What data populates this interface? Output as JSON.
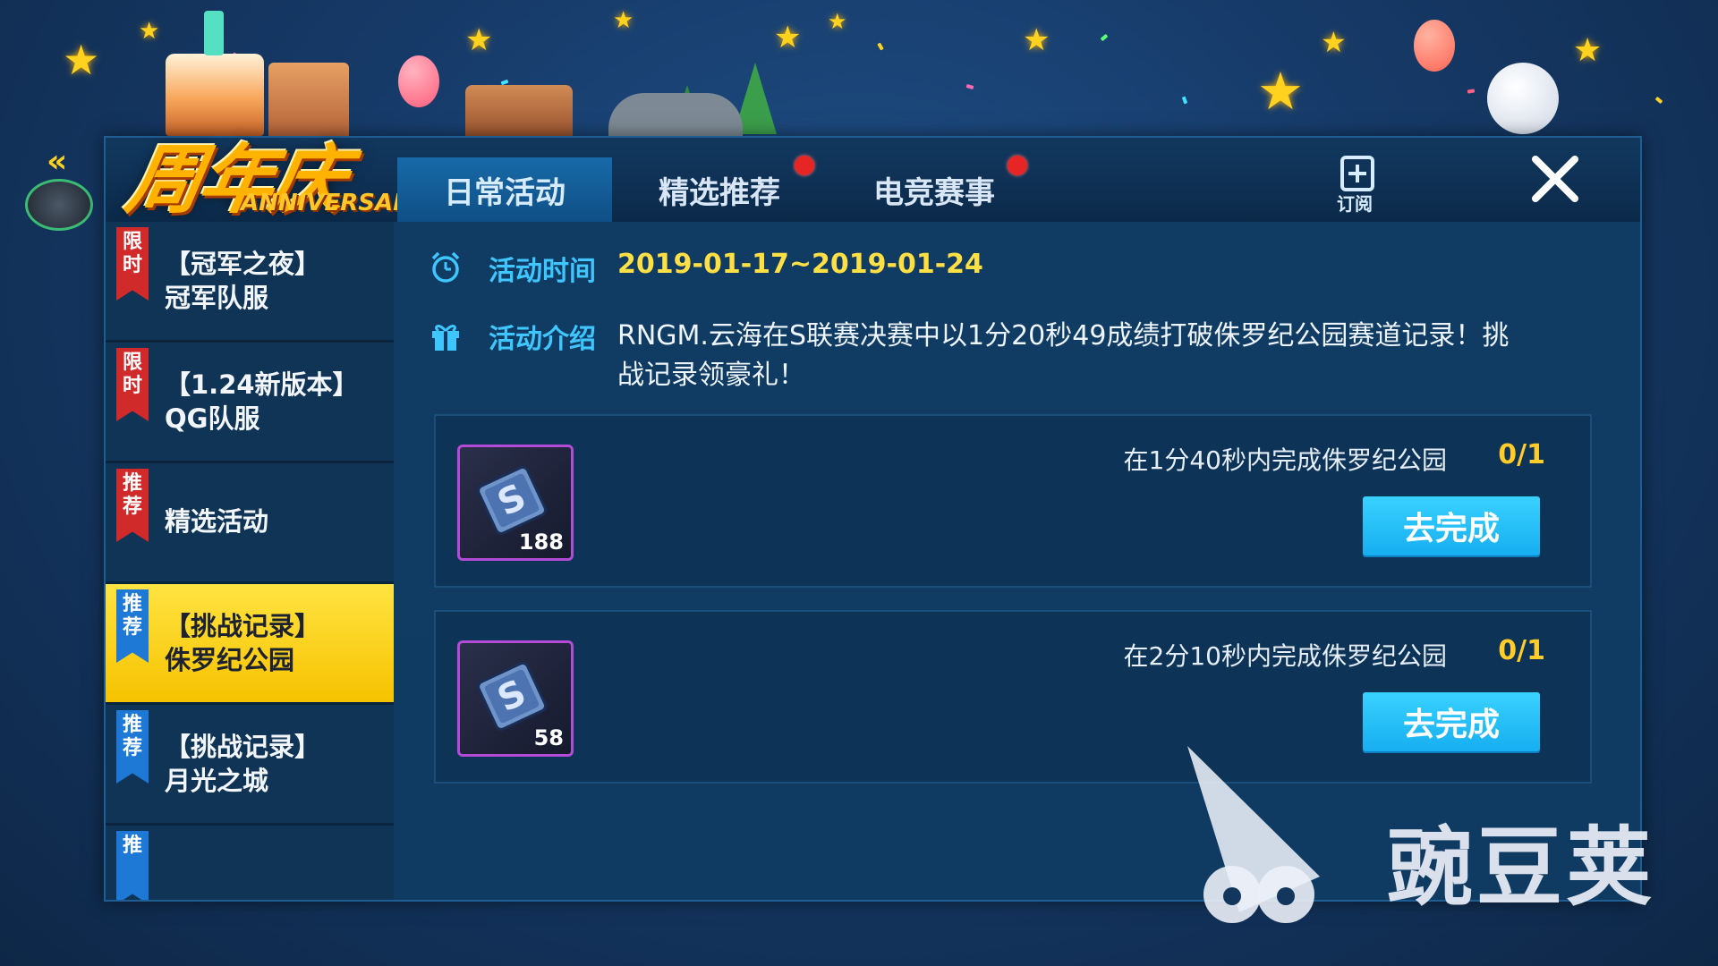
{
  "logo": {
    "title_cn": "周年庆",
    "title_en": "ANNIVERSARY"
  },
  "tabs": [
    {
      "label": "日常活动",
      "active": true,
      "badge": false
    },
    {
      "label": "精选推荐",
      "active": false,
      "badge": true
    },
    {
      "label": "电竞赛事",
      "active": false,
      "badge": true
    }
  ],
  "subscribe_label": "订阅",
  "sidebar": {
    "items": [
      {
        "tag": "限时",
        "tag_color": "red",
        "line1": "【冠军之夜】",
        "line2": "冠军队服",
        "active": false
      },
      {
        "tag": "限时",
        "tag_color": "red",
        "line1": "【1.24新版本】",
        "line2": "QG队服",
        "active": false
      },
      {
        "tag": "推荐",
        "tag_color": "red",
        "line1": "精选活动",
        "line2": "",
        "active": false
      },
      {
        "tag": "推荐",
        "tag_color": "blue",
        "line1": "【挑战记录】",
        "line2": "侏罗纪公园",
        "active": true
      },
      {
        "tag": "推荐",
        "tag_color": "blue",
        "line1": "【挑战记录】",
        "line2": "月光之城",
        "active": false
      },
      {
        "tag": "推",
        "tag_color": "blue",
        "line1": "",
        "line2": "",
        "active": false
      }
    ]
  },
  "activity": {
    "time_label": "活动时间",
    "time_value": "2019-01-17~2019-01-24",
    "intro_label": "活动介绍",
    "intro_text": "RNGM.云海在S联赛决赛中以1分20秒49成绩打破侏罗纪公园赛道记录！挑战记录领豪礼！"
  },
  "tasks": [
    {
      "reward_count": "188",
      "description": "在1分40秒内完成侏罗纪公园",
      "progress": "0/1",
      "button": "去完成"
    },
    {
      "reward_count": "58",
      "description": "在2分10秒内完成侏罗纪公园",
      "progress": "0/1",
      "button": "去完成"
    }
  ],
  "watermark": "豌豆荚",
  "colors": {
    "accent": "#3fc6ff",
    "highlight": "#ffe044",
    "active_item": "#f6c200",
    "button": "#16aef0"
  }
}
